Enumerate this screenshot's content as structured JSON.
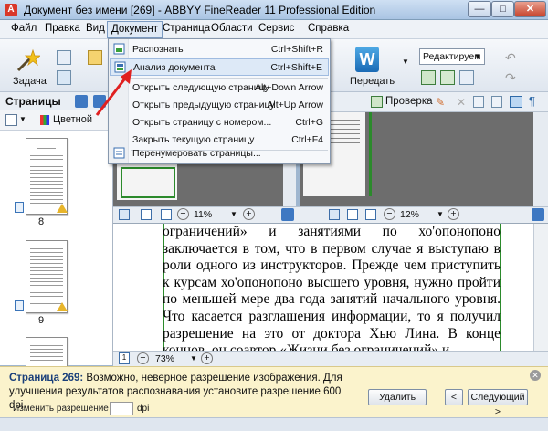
{
  "window": {
    "title": "Документ без имени [269] - ABBYY FineReader 11 Professional Edition",
    "app_icon": "A"
  },
  "menubar": {
    "items": [
      "Файл",
      "Правка",
      "Вид",
      "Документ",
      "Страница",
      "Области",
      "Сервис",
      "Справка"
    ],
    "active": "Документ"
  },
  "toolbar": {
    "task_label": "Задача",
    "send_label": "Передать",
    "mode_combo": "Редактируем",
    "word_icon_letter": "W"
  },
  "pages_panel": {
    "title": "Страницы",
    "color_mode": "Цветной",
    "pages": [
      {
        "number": "8"
      },
      {
        "number": "9"
      }
    ]
  },
  "right_toolbar": {
    "check_label": "Проверка"
  },
  "image_pane": {
    "zoom": "11%"
  },
  "zoom_pane": {
    "zoom": "12%"
  },
  "text_pane": {
    "zoom": "73%",
    "text": "ограничений» и занятиями по хо'опонопоно заключается в том, что в первом случае я выступаю в роли одного из инструкторов. Прежде чем приступить к курсам хо'опонопоно высшего уровня, нужно пройти по меньшей мере два года занятий начального уровня. Что касается разглашения информации, то я получил разрешение на это от доктора Хью Лина. В конце концов, он соавтор «Жизни без ограничений» и"
  },
  "document_menu": {
    "items": [
      {
        "label": "Распознать",
        "shortcut": "Ctrl+Shift+R"
      },
      {
        "label": "Анализ документа",
        "shortcut": "Ctrl+Shift+E"
      },
      {
        "label": "Открыть следующую страницу",
        "shortcut": "Alt+Down Arrow"
      },
      {
        "label": "Открыть предыдущую страницу",
        "shortcut": "Alt+Up Arrow"
      },
      {
        "label": "Открыть страницу с номером...",
        "shortcut": "Ctrl+G"
      },
      {
        "label": "Закрыть текущую страницу",
        "shortcut": "Ctrl+F4"
      },
      {
        "label": "Перенумеровать страницы...",
        "shortcut": ""
      }
    ],
    "highlighted": "Анализ документа"
  },
  "notice": {
    "page_label": "Страница 269:",
    "message": "Возможно, неверное разрешение изображения. Для улучшения результатов распознавания установите разрешение 600 dpi.",
    "resolution_label": "Изменить разрешение на:",
    "resolution_value": "",
    "dpi": "dpi",
    "delete_button": "Удалить",
    "prev_button": "<",
    "next_button": "Следующий >"
  },
  "colors": {
    "accent_arrow": "#e02020",
    "green_frame": "#2b8a2b",
    "notice_bg": "#fbf3cc"
  }
}
